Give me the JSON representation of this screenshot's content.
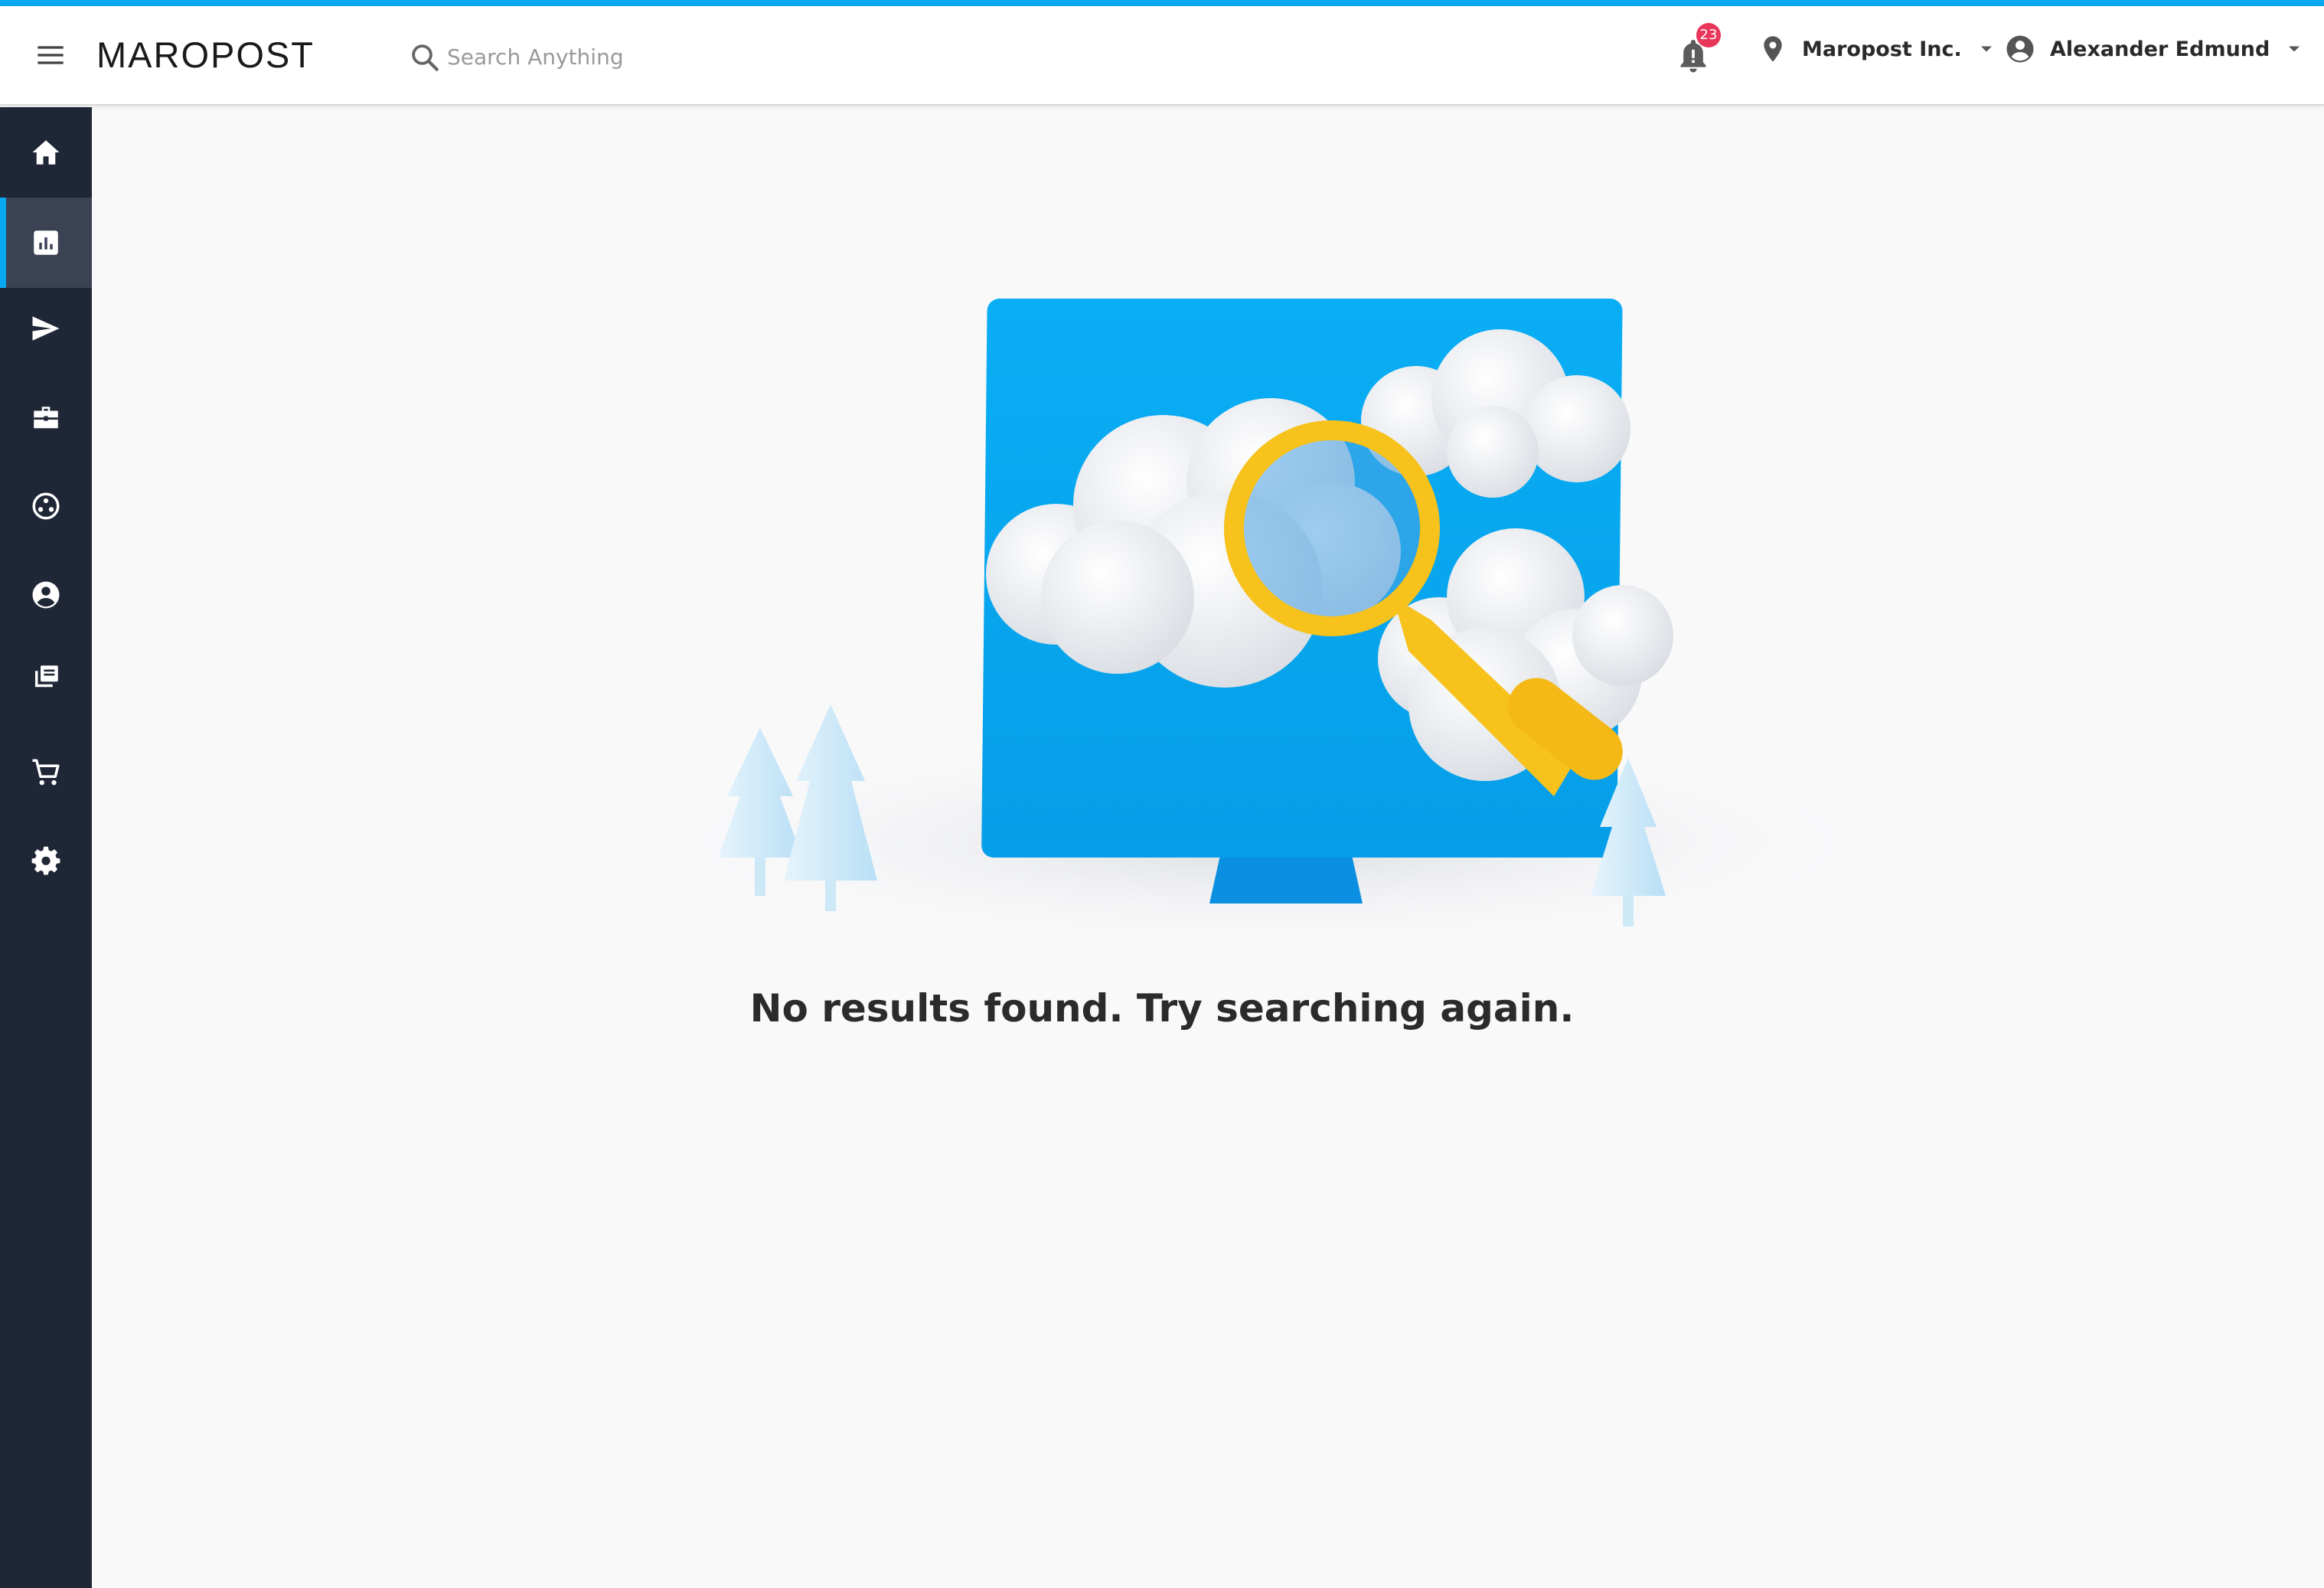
{
  "header": {
    "menu_icon": "hamburger-menu-icon",
    "logo_text": "MAROPOST",
    "search": {
      "placeholder": "Search Anything",
      "value": ""
    },
    "notifications": {
      "icon": "bell-icon",
      "count": "23"
    },
    "organization": {
      "icon": "location-pin-icon",
      "label": "Maropost Inc."
    },
    "user": {
      "icon": "account-circle-icon",
      "label": "Alexander Edmund"
    }
  },
  "sidebar": {
    "items": [
      {
        "icon": "home-icon",
        "active": false
      },
      {
        "icon": "analytics-chart-icon",
        "active": true
      },
      {
        "icon": "send-icon",
        "active": false
      },
      {
        "icon": "briefcase-icon",
        "active": false
      },
      {
        "icon": "segments-icon",
        "active": false
      },
      {
        "icon": "contact-icon",
        "active": false
      },
      {
        "icon": "library-icon",
        "active": false
      },
      {
        "icon": "cart-icon",
        "active": false
      },
      {
        "icon": "settings-gear-icon",
        "active": false
      }
    ]
  },
  "main": {
    "illustration": "monitor-with-clouds-and-magnifier",
    "empty_message": "No results found. Try searching again."
  },
  "colors": {
    "accent": "#0aa8f0",
    "sidebar_bg": "#1f2636",
    "badge": "#e8375b",
    "monitor": "#09aef2",
    "magnifier": "#f6c21b"
  }
}
